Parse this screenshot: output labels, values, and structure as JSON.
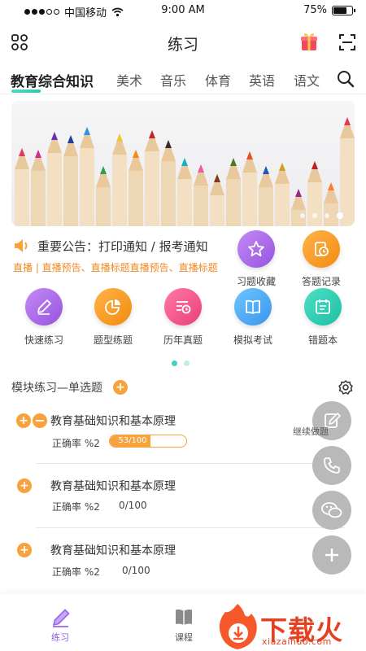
{
  "status_bar": {
    "carrier": "中国移动",
    "time": "9:00 AM",
    "battery": "75%",
    "battery_level": 0.75
  },
  "header": {
    "title": "练习"
  },
  "tabs": [
    {
      "label": "教育综合知识"
    },
    {
      "label": "美术"
    },
    {
      "label": "音乐"
    },
    {
      "label": "体育"
    },
    {
      "label": "英语"
    },
    {
      "label": "语文"
    }
  ],
  "notice": {
    "text": "重要公告：打印通知 / 报考通知",
    "links": "直播 | 直播预告、直播标题直播预告、直播标题"
  },
  "quick_actions": [
    {
      "label": "习题收藏",
      "icon": "star-icon"
    },
    {
      "label": "答题记录",
      "icon": "clock-document-icon"
    },
    {
      "label": "快速练习",
      "icon": "pencil-icon"
    },
    {
      "label": "题型练题",
      "icon": "pie-chart-icon"
    },
    {
      "label": "历年真题",
      "icon": "history-list-icon"
    },
    {
      "label": "模拟考试",
      "icon": "book-icon"
    },
    {
      "label": "错题本",
      "icon": "notebook-icon"
    }
  ],
  "module": {
    "title": "模块练习—单选题",
    "items": [
      {
        "title": "教育基础知识和基本原理",
        "accuracy": "正确率 %2",
        "progress_text": "53/100",
        "progress": 0.53
      },
      {
        "title": "教育基础知识和基本原理",
        "accuracy": "正确率 %2",
        "progress_text": "0/100"
      },
      {
        "title": "教育基础知识和基本原理",
        "accuracy": "正确率 %2",
        "progress_text": "0/100"
      }
    ]
  },
  "floating": {
    "continue_label": "继续做题"
  },
  "bottom_nav": [
    {
      "label": "练习",
      "active": true
    },
    {
      "label": "课程",
      "active": false
    }
  ],
  "watermark": {
    "text": "下载火",
    "url": "xiazaihuo.com"
  },
  "colors": {
    "accent": "#3cd3c0",
    "orange": "#f7a23c",
    "purple": "#a46be8",
    "pink": "#f0558b",
    "blue": "#4aa8f0",
    "teal": "#2fd0b6"
  }
}
